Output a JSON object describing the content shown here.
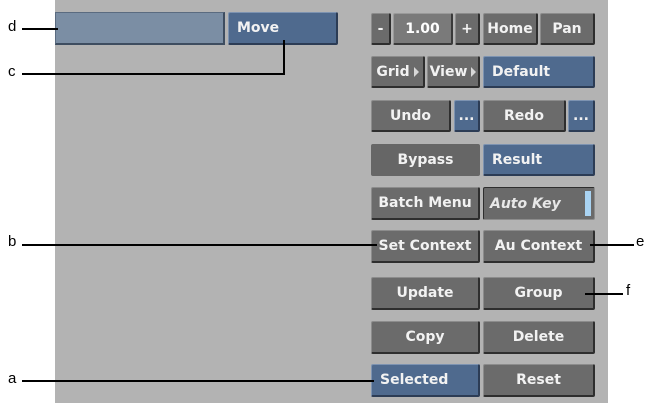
{
  "callouts": {
    "a": "a",
    "b": "b",
    "c": "c",
    "d": "d",
    "e": "e",
    "f": "f"
  },
  "toolbar": {
    "move_label": "Move",
    "zoom_minus": "-",
    "zoom_value": "1.00",
    "zoom_plus": "+",
    "home_label": "Home",
    "pan_label": "Pan",
    "grid_label": "Grid",
    "view_label": "View",
    "default_label": "Default",
    "undo_label": "Undo",
    "undo_more": "...",
    "redo_label": "Redo",
    "redo_more": "...",
    "bypass_label": "Bypass",
    "result_label": "Result",
    "batch_menu_label": "Batch Menu",
    "auto_key_label": "Auto Key",
    "set_context_label": "Set Context",
    "au_context_label": "Au Context",
    "update_label": "Update",
    "group_label": "Group",
    "copy_label": "Copy",
    "delete_label": "Delete",
    "selected_label": "Selected",
    "reset_label": "Reset"
  },
  "colors": {
    "panel": "#b3b3b3",
    "button_gray": "#6b6b6b",
    "button_blue": "#4f6a8e",
    "field": "#7b8ea4",
    "auto_key_indicator": "#a9d3f2"
  }
}
